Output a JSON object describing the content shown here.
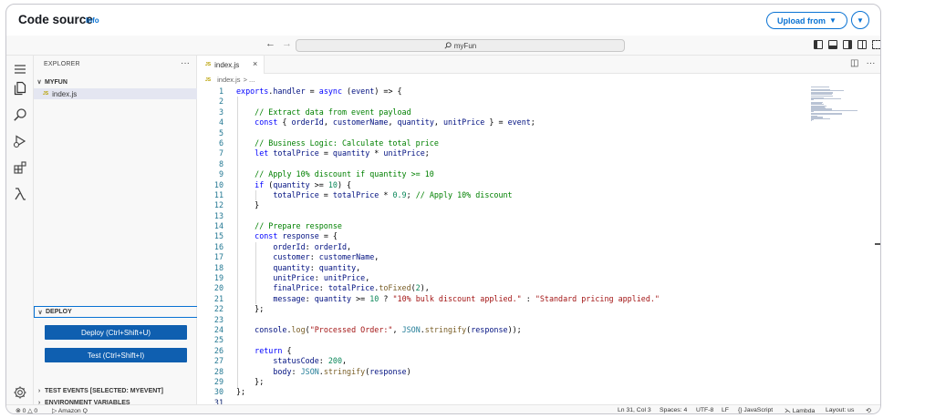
{
  "header": {
    "title": "Code source",
    "info": "Info",
    "upload_label": "Upload from",
    "upload_caret": "▼",
    "dropdown_caret": "▼"
  },
  "titlebar": {
    "back": "←",
    "forward": "→",
    "search_text": "myFun",
    "search_icon": "search-icon"
  },
  "sidebar": {
    "heading": "EXPLORER",
    "more": "···",
    "folder": "MYFUN",
    "file": "index.js",
    "deploy_section": "DEPLOY",
    "deploy_button": "Deploy (Ctrl+Shift+U)",
    "test_button": "Test (Ctrl+Shift+I)",
    "test_events_section": "TEST EVENTS [SELECTED: MYEVENT]",
    "env_vars_section": "ENVIRONMENT VARIABLES"
  },
  "editor": {
    "tab_label": "index.js",
    "tab_close": "×",
    "js_badge": "JS",
    "breadcrumb_file": "index.js",
    "breadcrumb_rest": "> ...",
    "code_lines": [
      [
        [
          "kw",
          "exports"
        ],
        [
          "plain",
          "."
        ],
        [
          "var",
          "handler"
        ],
        [
          "plain",
          " = "
        ],
        [
          "kw",
          "async"
        ],
        [
          "plain",
          " ("
        ],
        [
          "var",
          "event"
        ],
        [
          "plain",
          ") => {"
        ]
      ],
      [],
      [
        [
          "plain",
          "    "
        ],
        [
          "cm",
          "// Extract data from event payload"
        ]
      ],
      [
        [
          "plain",
          "    "
        ],
        [
          "kw",
          "const"
        ],
        [
          "plain",
          " { "
        ],
        [
          "var",
          "orderId"
        ],
        [
          "plain",
          ", "
        ],
        [
          "var",
          "customerName"
        ],
        [
          "plain",
          ", "
        ],
        [
          "var",
          "quantity"
        ],
        [
          "plain",
          ", "
        ],
        [
          "var",
          "unitPrice"
        ],
        [
          "plain",
          " } = "
        ],
        [
          "var",
          "event"
        ],
        [
          "plain",
          ";"
        ]
      ],
      [],
      [
        [
          "plain",
          "    "
        ],
        [
          "cm",
          "// Business Logic: Calculate total price"
        ]
      ],
      [
        [
          "plain",
          "    "
        ],
        [
          "kw",
          "let"
        ],
        [
          "plain",
          " "
        ],
        [
          "var",
          "totalPrice"
        ],
        [
          "plain",
          " = "
        ],
        [
          "var",
          "quantity"
        ],
        [
          "plain",
          " * "
        ],
        [
          "var",
          "unitPrice"
        ],
        [
          "plain",
          ";"
        ]
      ],
      [],
      [
        [
          "plain",
          "    "
        ],
        [
          "cm",
          "// Apply 10% discount if quantity >= 10"
        ]
      ],
      [
        [
          "plain",
          "    "
        ],
        [
          "kw",
          "if"
        ],
        [
          "plain",
          " ("
        ],
        [
          "var",
          "quantity"
        ],
        [
          "plain",
          " >= "
        ],
        [
          "num",
          "10"
        ],
        [
          "plain",
          ") {"
        ]
      ],
      [
        [
          "plain",
          "        "
        ],
        [
          "var",
          "totalPrice"
        ],
        [
          "plain",
          " = "
        ],
        [
          "var",
          "totalPrice"
        ],
        [
          "plain",
          " * "
        ],
        [
          "num",
          "0.9"
        ],
        [
          "plain",
          "; "
        ],
        [
          "cm",
          "// Apply 10% discount"
        ]
      ],
      [
        [
          "plain",
          "    }"
        ]
      ],
      [],
      [
        [
          "plain",
          "    "
        ],
        [
          "cm",
          "// Prepare response"
        ]
      ],
      [
        [
          "plain",
          "    "
        ],
        [
          "kw",
          "const"
        ],
        [
          "plain",
          " "
        ],
        [
          "var",
          "response"
        ],
        [
          "plain",
          " = {"
        ]
      ],
      [
        [
          "plain",
          "        "
        ],
        [
          "var",
          "orderId"
        ],
        [
          "plain",
          ": "
        ],
        [
          "var",
          "orderId"
        ],
        [
          "plain",
          ","
        ]
      ],
      [
        [
          "plain",
          "        "
        ],
        [
          "var",
          "customer"
        ],
        [
          "plain",
          ": "
        ],
        [
          "var",
          "customerName"
        ],
        [
          "plain",
          ","
        ]
      ],
      [
        [
          "plain",
          "        "
        ],
        [
          "var",
          "quantity"
        ],
        [
          "plain",
          ": "
        ],
        [
          "var",
          "quantity"
        ],
        [
          "plain",
          ","
        ]
      ],
      [
        [
          "plain",
          "        "
        ],
        [
          "var",
          "unitPrice"
        ],
        [
          "plain",
          ": "
        ],
        [
          "var",
          "unitPrice"
        ],
        [
          "plain",
          ","
        ]
      ],
      [
        [
          "plain",
          "        "
        ],
        [
          "var",
          "finalPrice"
        ],
        [
          "plain",
          ": "
        ],
        [
          "var",
          "totalPrice"
        ],
        [
          "plain",
          "."
        ],
        [
          "fn",
          "toFixed"
        ],
        [
          "plain",
          "("
        ],
        [
          "num",
          "2"
        ],
        [
          "plain",
          "),"
        ]
      ],
      [
        [
          "plain",
          "        "
        ],
        [
          "var",
          "message"
        ],
        [
          "plain",
          ": "
        ],
        [
          "var",
          "quantity"
        ],
        [
          "plain",
          " >= "
        ],
        [
          "num",
          "10"
        ],
        [
          "plain",
          " ? "
        ],
        [
          "str",
          "\"10% bulk discount applied.\""
        ],
        [
          "plain",
          " : "
        ],
        [
          "str",
          "\"Standard pricing applied.\""
        ]
      ],
      [
        [
          "plain",
          "    };"
        ]
      ],
      [],
      [
        [
          "plain",
          "    "
        ],
        [
          "var",
          "console"
        ],
        [
          "plain",
          "."
        ],
        [
          "fn",
          "log"
        ],
        [
          "plain",
          "("
        ],
        [
          "str",
          "\"Processed Order:\""
        ],
        [
          "plain",
          ", "
        ],
        [
          "cls",
          "JSON"
        ],
        [
          "plain",
          "."
        ],
        [
          "fn",
          "stringify"
        ],
        [
          "plain",
          "("
        ],
        [
          "var",
          "response"
        ],
        [
          "plain",
          "));"
        ]
      ],
      [],
      [
        [
          "plain",
          "    "
        ],
        [
          "kw",
          "return"
        ],
        [
          "plain",
          " {"
        ]
      ],
      [
        [
          "plain",
          "        "
        ],
        [
          "var",
          "statusCode"
        ],
        [
          "plain",
          ": "
        ],
        [
          "num",
          "200"
        ],
        [
          "plain",
          ","
        ]
      ],
      [
        [
          "plain",
          "        "
        ],
        [
          "var",
          "body"
        ],
        [
          "plain",
          ": "
        ],
        [
          "cls",
          "JSON"
        ],
        [
          "plain",
          "."
        ],
        [
          "fn",
          "stringify"
        ],
        [
          "plain",
          "("
        ],
        [
          "var",
          "response"
        ],
        [
          "plain",
          ")"
        ]
      ],
      [
        [
          "plain",
          "    };"
        ]
      ],
      [
        [
          "plain",
          "};"
        ]
      ],
      []
    ],
    "line_numbers": [
      "1",
      "2",
      "3",
      "4",
      "5",
      "6",
      "7",
      "8",
      "9",
      "10",
      "11",
      "12",
      "13",
      "14",
      "15",
      "16",
      "17",
      "18",
      "19",
      "20",
      "21",
      "22",
      "23",
      "24",
      "25",
      "26",
      "27",
      "28",
      "29",
      "30",
      "31"
    ],
    "current_line": 31
  },
  "statusbar": {
    "problems": "⊗ 0 △ 0",
    "amazonq": "Amazon Q",
    "position": "Ln 31, Col 3",
    "spaces": "Spaces: 4",
    "encoding": "UTF-8",
    "eol": "LF",
    "language": "{} JavaScript",
    "lambda": "Lambda",
    "layout": "Layout: us"
  }
}
